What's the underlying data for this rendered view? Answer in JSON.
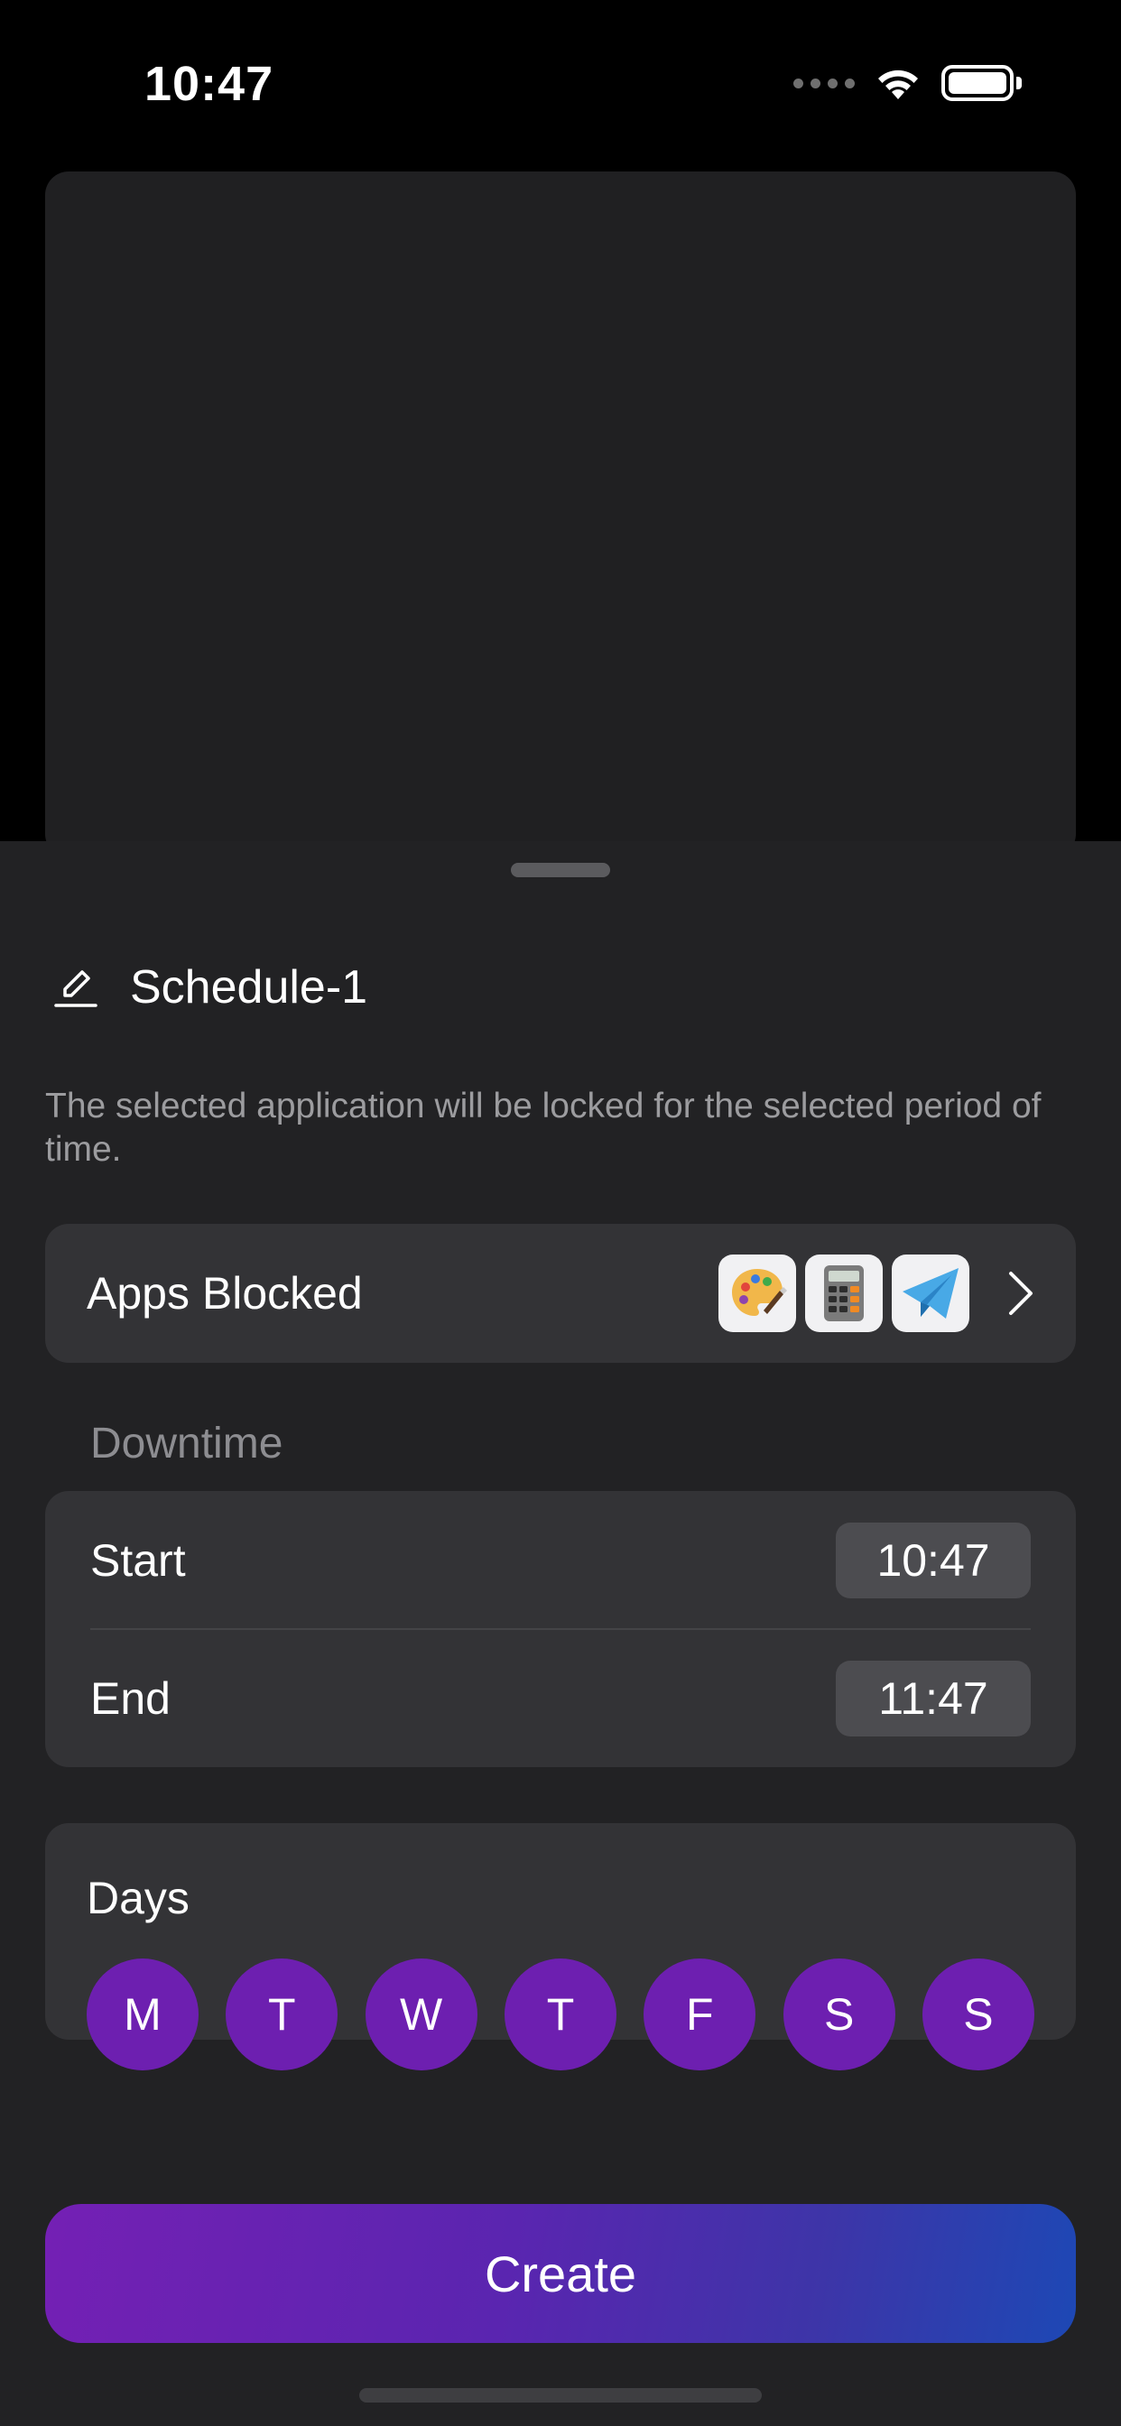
{
  "status_bar": {
    "time": "10:47"
  },
  "sheet": {
    "schedule_name": "Schedule-1",
    "description": "The selected application will be locked for the selected period of time.",
    "apps_blocked": {
      "label": "Apps Blocked",
      "icons": [
        "palette-app-icon",
        "calculator-app-icon",
        "telegram-app-icon"
      ]
    },
    "downtime": {
      "section_label": "Downtime",
      "start_label": "Start",
      "start_time": "10:47",
      "end_label": "End",
      "end_time": "11:47"
    },
    "days": {
      "label": "Days",
      "items": [
        "M",
        "T",
        "W",
        "T",
        "F",
        "S",
        "S"
      ],
      "selected_color": "#6d1fb0"
    },
    "create_label": "Create"
  },
  "colors": {
    "accent_gradient_start": "#7420b4",
    "accent_gradient_end": "#1d48b5",
    "sheet_background": "#222224",
    "card_background": "#333336"
  }
}
